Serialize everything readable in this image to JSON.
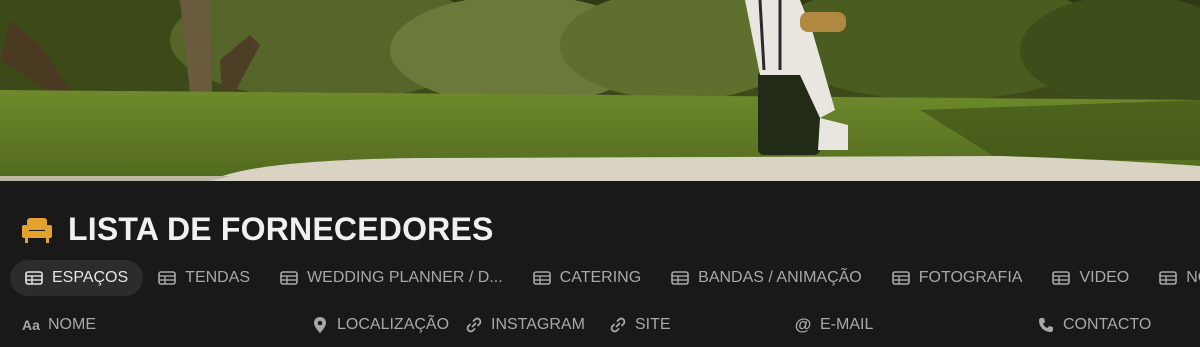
{
  "page": {
    "title": "LISTA DE FORNECEDORES",
    "title_icon": "armchair-icon",
    "accent_color": "#e3a22c"
  },
  "tabs": [
    {
      "label": "ESPAÇOS",
      "icon": "table-icon",
      "active": true
    },
    {
      "label": "TENDAS",
      "icon": "table-icon",
      "active": false
    },
    {
      "label": "WEDDING PLANNER / D...",
      "icon": "table-icon",
      "active": false
    },
    {
      "label": "CATERING",
      "icon": "table-icon",
      "active": false
    },
    {
      "label": "BANDAS / ANIMAÇÃO",
      "icon": "table-icon",
      "active": false
    },
    {
      "label": "FOTOGRAFIA",
      "icon": "table-icon",
      "active": false
    },
    {
      "label": "VIDEO",
      "icon": "table-icon",
      "active": false
    },
    {
      "label": "NOIVA",
      "icon": "table-icon",
      "active": false
    }
  ],
  "properties": [
    {
      "label": "NOME",
      "icon": "text-type-icon",
      "icon_text": "Aa"
    },
    {
      "label": "LOCALIZAÇÃO",
      "icon": "location-pin-icon"
    },
    {
      "label": "INSTAGRAM",
      "icon": "link-icon"
    },
    {
      "label": "SITE",
      "icon": "link-icon"
    },
    {
      "label": "E-MAIL",
      "icon": "at-sign-icon",
      "icon_text": "@"
    },
    {
      "label": "CONTACTO",
      "icon": "phone-icon"
    }
  ]
}
